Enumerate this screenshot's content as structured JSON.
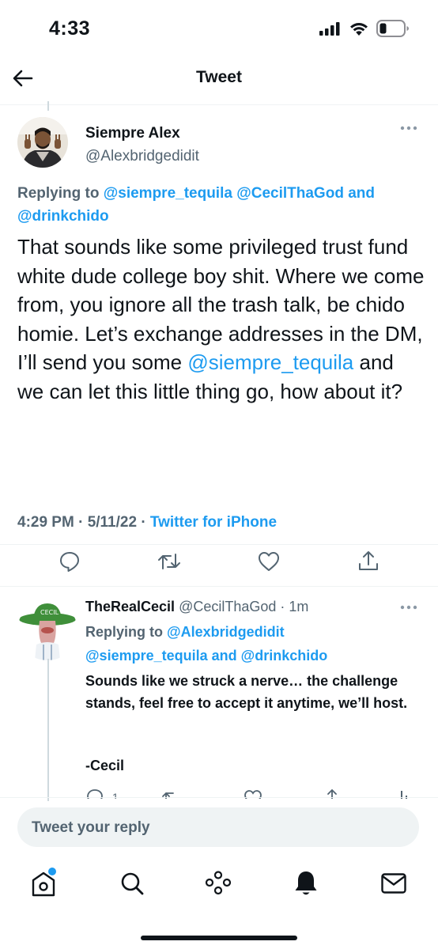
{
  "status_bar": {
    "time": "4:33"
  },
  "header": {
    "title": "Tweet"
  },
  "tweet": {
    "author": {
      "name": "Siempre Alex",
      "handle": "@Alexbridgedidit"
    },
    "replying_label": "Replying to",
    "replying_to": [
      "@siempre_tequila",
      "@CecilThaGod",
      "@drinkchido"
    ],
    "replying_and": "and",
    "text_part1": "That sounds like some privileged trust fund white dude college boy shit. Where we come from, you ignore all the trash talk, be chido homie. Let’s exchange addresses in the DM, I’ll send you some ",
    "text_mention": "@siempre_tequila",
    "text_part2": " and we can let this little thing go, how about it?",
    "timestamp": "4:29 PM · 5/11/22 · ",
    "source": "Twitter for iPhone"
  },
  "reply": {
    "author": {
      "name": "TheRealCecil",
      "handle": "@CecilThaGod",
      "time": "· 1m"
    },
    "replying_label": "Replying to",
    "replying_to": [
      "@Alexbridgedidit",
      "@siempre_tequila",
      "@drinkchido"
    ],
    "replying_and": "and",
    "text": "Sounds like we struck a nerve… the challenge stands, feel free to accept it anytime, we’ll host.",
    "signature": "-Cecil",
    "reply_count": "1"
  },
  "reply_box": {
    "placeholder": "Tweet your reply"
  },
  "icons": {
    "back": "arrow-left-icon",
    "more": "more-dots-icon",
    "reply": "comment-icon",
    "retweet": "retweet-icon",
    "like": "heart-icon",
    "share": "share-icon",
    "analytics": "analytics-icon",
    "home": "home-icon",
    "search": "search-icon",
    "spaces": "spaces-icon",
    "notifications": "bell-icon",
    "messages": "mail-icon"
  },
  "colors": {
    "accent": "#1d9bf0",
    "text": "#0f1419",
    "secondary": "#536471",
    "notification_dot": "#1d9bf0"
  }
}
